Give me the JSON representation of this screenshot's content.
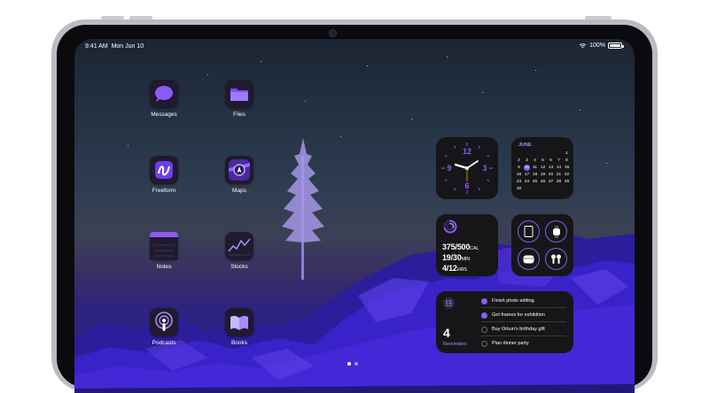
{
  "status": {
    "time": "9:41 AM",
    "date": "Mon Jun 10",
    "battery": "100%"
  },
  "apps": [
    {
      "name": "Messages",
      "icon": "messages-icon"
    },
    {
      "name": "Files",
      "icon": "files-icon"
    },
    {
      "name": "Freeform",
      "icon": "freeform-icon"
    },
    {
      "name": "Maps",
      "icon": "maps-icon"
    },
    {
      "name": "Notes",
      "icon": "notes-icon"
    },
    {
      "name": "Stocks",
      "icon": "stocks-icon"
    },
    {
      "name": "Podcasts",
      "icon": "podcasts-icon"
    },
    {
      "name": "Books",
      "icon": "books-icon"
    }
  ],
  "clock": {
    "numerals": [
      "12",
      "3",
      "6",
      "9"
    ]
  },
  "calendar": {
    "month": "JUNE",
    "rows": [
      [
        "",
        "",
        "",
        "",
        "",
        "",
        "1"
      ],
      [
        "2",
        "3",
        "4",
        "5",
        "6",
        "7",
        "8"
      ],
      [
        "9",
        "10",
        "11",
        "12",
        "13",
        "14",
        "15"
      ],
      [
        "16",
        "17",
        "18",
        "19",
        "20",
        "21",
        "22"
      ],
      [
        "23",
        "24",
        "25",
        "26",
        "27",
        "28",
        "29"
      ],
      [
        "30",
        "",
        "",
        "",
        "",
        "",
        ""
      ]
    ],
    "today": "10"
  },
  "fitness": {
    "move_value": "375/500",
    "move_unit": "CAL",
    "exercise_value": "19/30",
    "exercise_unit": "MIN",
    "stand_value": "4/12",
    "stand_unit": "HRS"
  },
  "reminders": {
    "count": "4",
    "label": "Reminders",
    "items": [
      {
        "text": "Finish photo editing",
        "done": true
      },
      {
        "text": "Get frames for exhibition",
        "done": true
      },
      {
        "text": "Buy Orkun's birthday gift",
        "done": false
      },
      {
        "text": "Plan dinner party",
        "done": false
      }
    ]
  },
  "colors": {
    "accent": "#8b5cf6",
    "widget_bg": "#161618",
    "rock_purple": "#3b1fd1"
  },
  "page_dots": {
    "count": 2,
    "active": 0
  }
}
